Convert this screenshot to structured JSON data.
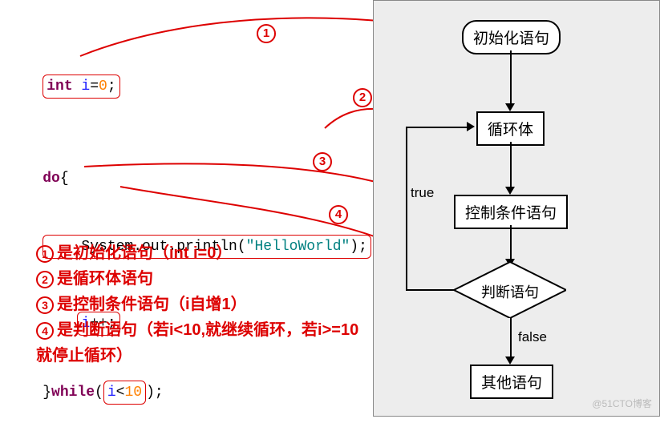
{
  "code": {
    "line1_kw": "int",
    "line1_var": " i",
    "line1_eq": "=",
    "line1_num": "0",
    "line1_semi": ";",
    "line2_do": "do",
    "line2_brace": "{",
    "line3": "    System.out.println(",
    "line3_str": "\"HelloWorld\"",
    "line3_end": ");",
    "line4": "    ",
    "line4_a": "i",
    "line4_b": "++;",
    "line5_a": "}",
    "line5_while": "while",
    "line5_p1": "(",
    "line5_cond1": "i",
    "line5_lt": "<",
    "line5_cond2": "10",
    "line5_p2": ")",
    "line5_semi": ";"
  },
  "markers": {
    "m1": "1",
    "m2": "2",
    "m3": "3",
    "m4": "4"
  },
  "notes": {
    "n1": "是初始化语句（int i=0）",
    "n2": "是循环体语句",
    "n3": "是控制条件语句（i自增1）",
    "n4": "是判断语句（若i<10,就继续循环，若i>=10就停止循环）"
  },
  "flow": {
    "init": "初始化语句",
    "body": "循环体",
    "control": "控制条件语句",
    "judge": "判断语句",
    "other": "其他语句",
    "true": "true",
    "false": "false"
  },
  "watermark": "@51CTO博客"
}
